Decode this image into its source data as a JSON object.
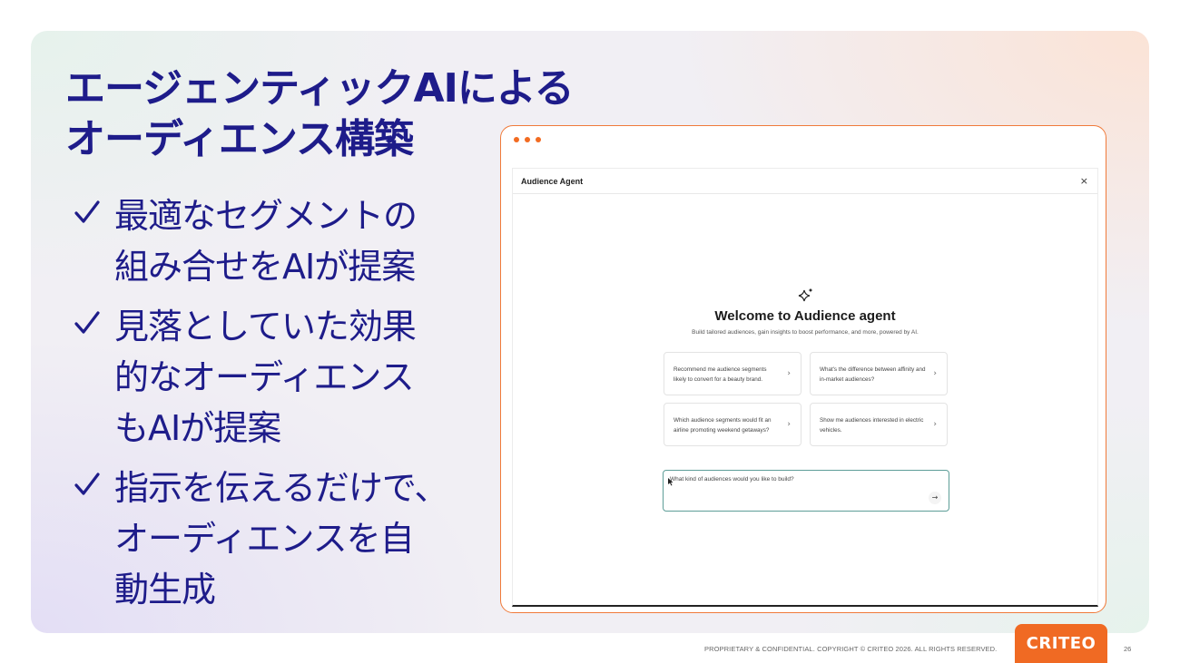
{
  "slide": {
    "title_lines": [
      "エージェンティックAIによる",
      "オーディエンス構築"
    ],
    "bullets": [
      {
        "lines": [
          "最適なセグメントの",
          "組み合せをAIが提案"
        ]
      },
      {
        "lines": [
          "見落としていた効果",
          "的なオーディエンス",
          "もAIが提案"
        ]
      },
      {
        "lines": [
          "指示を伝えるだけで、",
          "オーディエンスを自",
          "動生成"
        ]
      }
    ],
    "accent_color": "#1e1c8a",
    "brand_color": "#f06a23"
  },
  "app": {
    "title": "Audience Agent",
    "close_label": "×",
    "welcome_title": "Welcome to Audience agent",
    "welcome_subtitle": "Build tailored audiences, gain insights to boost performance, and more, powered by AI.",
    "suggestions": [
      {
        "text": "Recommend me audience segments likely to convert for a beauty brand."
      },
      {
        "text": "What's the difference between affinity and in-market audiences?"
      },
      {
        "text": "Which audience segments would fit an airline promoting weekend getaways?"
      },
      {
        "text": "Show me audiences interested in electric vehicles."
      }
    ],
    "prompt_placeholder": "What kind of audiences would you like to build?",
    "send_label": "→"
  },
  "footer": {
    "copyright": "PROPRIETARY & CONFIDENTIAL. COPYRIGHT © CRITEO 2026. ALL RIGHTS RESERVED.",
    "logo_text": "CRITEO",
    "page_number": "26"
  }
}
